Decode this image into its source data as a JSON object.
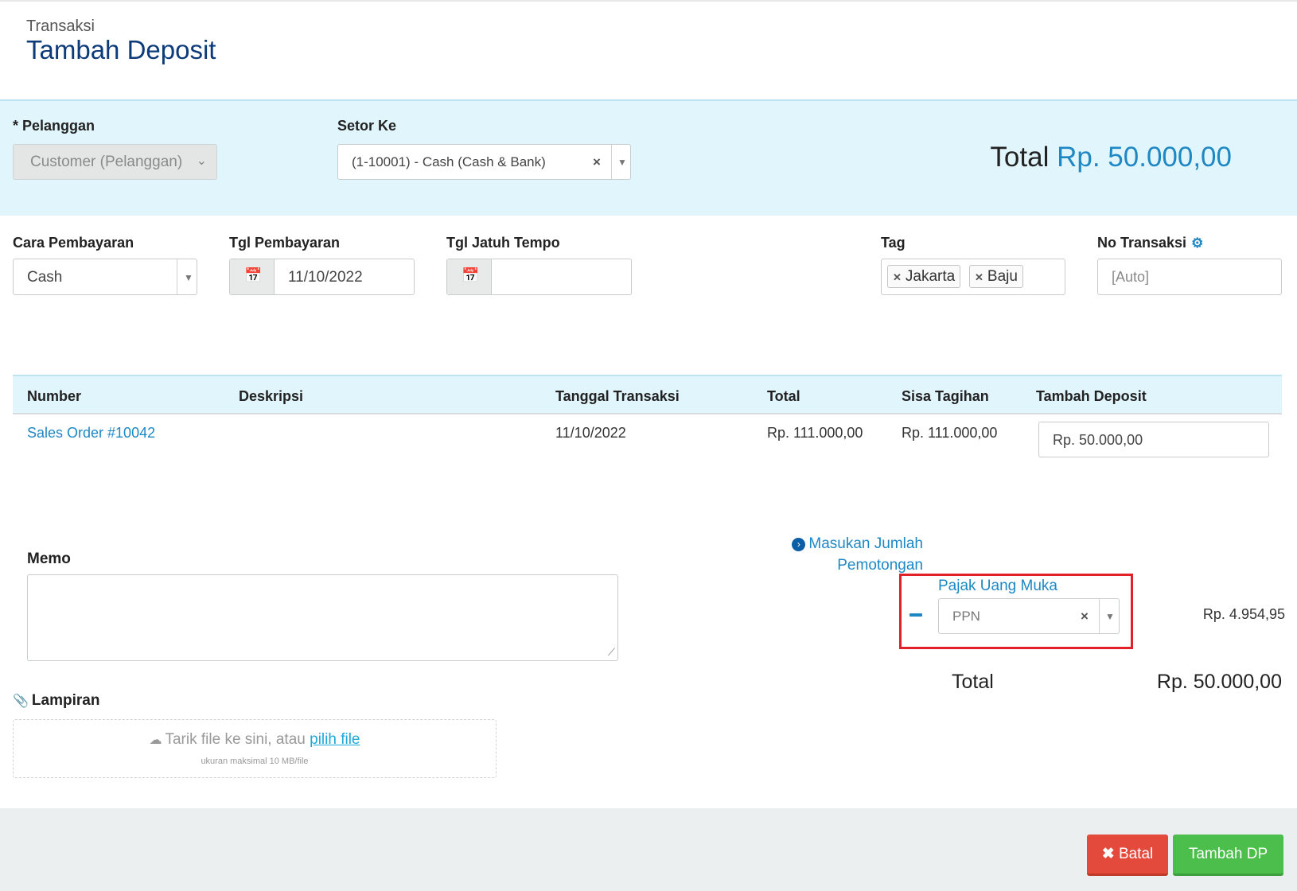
{
  "header": {
    "breadcrumb": "Transaksi",
    "title": "Tambah Deposit"
  },
  "top_form": {
    "customer_label": "* Pelanggan",
    "customer_placeholder": "Customer (Pelanggan)",
    "deposit_to_label": "Setor Ke",
    "deposit_to_value": "(1-10001) - Cash (Cash & Bank)",
    "total_label": "Total",
    "total_value": "Rp. 50.000,00"
  },
  "details": {
    "payment_method_label": "Cara Pembayaran",
    "payment_method_value": "Cash",
    "payment_date_label": "Tgl Pembayaran",
    "payment_date_value": "11/10/2022",
    "due_date_label": "Tgl Jatuh Tempo",
    "due_date_value": "",
    "tag_label": "Tag",
    "tags": [
      "Jakarta",
      "Baju"
    ],
    "trx_no_label": "No Transaksi",
    "trx_no_placeholder": "[Auto]"
  },
  "table": {
    "headers": [
      "Number",
      "Deskripsi",
      "Tanggal Transaksi",
      "Total",
      "Sisa Tagihan",
      "Tambah Deposit"
    ],
    "rows": [
      {
        "number": "Sales Order #10042",
        "description": "",
        "date": "11/10/2022",
        "total": "Rp. 111.000,00",
        "remaining": "Rp. 111.000,00",
        "deposit": "Rp. 50.000,00"
      }
    ]
  },
  "memo": {
    "label": "Memo",
    "value": ""
  },
  "deduction": {
    "link_line1": "Masukan Jumlah",
    "link_line2": "Pemotongan",
    "tax_label": "Pajak Uang Muka",
    "tax_value": "PPN",
    "tax_amount": "Rp. 4.954,95"
  },
  "summary": {
    "total_label": "Total",
    "total_value": "Rp. 50.000,00"
  },
  "attachment": {
    "label": "Lampiran",
    "drop_text": "Tarik file ke sini, atau",
    "pick_link": "pilih file",
    "size_note": "ukuran maksimal 10 MB/file"
  },
  "footer": {
    "cancel_label": "Batal",
    "save_label": "Tambah DP"
  },
  "colors": {
    "accent": "#1d88c4",
    "title": "#0d3b7a",
    "band": "#e1f5fc",
    "danger": "#e44a3c",
    "success": "#4cbe4c",
    "highlight": "#e1202a"
  }
}
